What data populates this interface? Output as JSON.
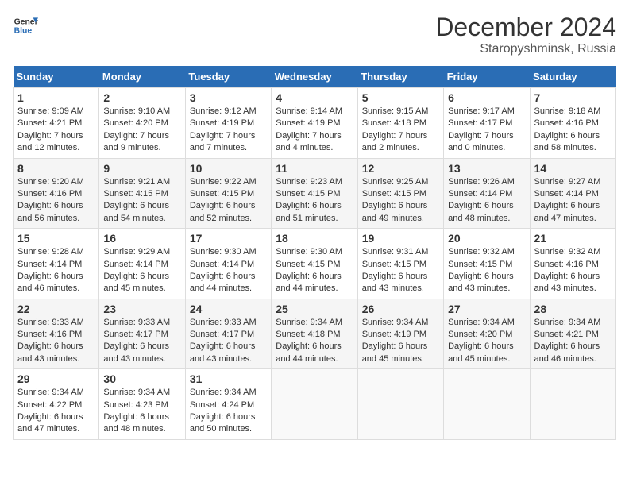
{
  "header": {
    "logo_line1": "General",
    "logo_line2": "Blue",
    "month": "December 2024",
    "location": "Staropyshminsk, Russia"
  },
  "days_of_week": [
    "Sunday",
    "Monday",
    "Tuesday",
    "Wednesday",
    "Thursday",
    "Friday",
    "Saturday"
  ],
  "weeks": [
    [
      {
        "day": "1",
        "sunrise": "9:09 AM",
        "sunset": "4:21 PM",
        "daylight": "7 hours and 12 minutes."
      },
      {
        "day": "2",
        "sunrise": "9:10 AM",
        "sunset": "4:20 PM",
        "daylight": "7 hours and 9 minutes."
      },
      {
        "day": "3",
        "sunrise": "9:12 AM",
        "sunset": "4:19 PM",
        "daylight": "7 hours and 7 minutes."
      },
      {
        "day": "4",
        "sunrise": "9:14 AM",
        "sunset": "4:19 PM",
        "daylight": "7 hours and 4 minutes."
      },
      {
        "day": "5",
        "sunrise": "9:15 AM",
        "sunset": "4:18 PM",
        "daylight": "7 hours and 2 minutes."
      },
      {
        "day": "6",
        "sunrise": "9:17 AM",
        "sunset": "4:17 PM",
        "daylight": "7 hours and 0 minutes."
      },
      {
        "day": "7",
        "sunrise": "9:18 AM",
        "sunset": "4:16 PM",
        "daylight": "6 hours and 58 minutes."
      }
    ],
    [
      {
        "day": "8",
        "sunrise": "9:20 AM",
        "sunset": "4:16 PM",
        "daylight": "6 hours and 56 minutes."
      },
      {
        "day": "9",
        "sunrise": "9:21 AM",
        "sunset": "4:15 PM",
        "daylight": "6 hours and 54 minutes."
      },
      {
        "day": "10",
        "sunrise": "9:22 AM",
        "sunset": "4:15 PM",
        "daylight": "6 hours and 52 minutes."
      },
      {
        "day": "11",
        "sunrise": "9:23 AM",
        "sunset": "4:15 PM",
        "daylight": "6 hours and 51 minutes."
      },
      {
        "day": "12",
        "sunrise": "9:25 AM",
        "sunset": "4:15 PM",
        "daylight": "6 hours and 49 minutes."
      },
      {
        "day": "13",
        "sunrise": "9:26 AM",
        "sunset": "4:14 PM",
        "daylight": "6 hours and 48 minutes."
      },
      {
        "day": "14",
        "sunrise": "9:27 AM",
        "sunset": "4:14 PM",
        "daylight": "6 hours and 47 minutes."
      }
    ],
    [
      {
        "day": "15",
        "sunrise": "9:28 AM",
        "sunset": "4:14 PM",
        "daylight": "6 hours and 46 minutes."
      },
      {
        "day": "16",
        "sunrise": "9:29 AM",
        "sunset": "4:14 PM",
        "daylight": "6 hours and 45 minutes."
      },
      {
        "day": "17",
        "sunrise": "9:30 AM",
        "sunset": "4:14 PM",
        "daylight": "6 hours and 44 minutes."
      },
      {
        "day": "18",
        "sunrise": "9:30 AM",
        "sunset": "4:15 PM",
        "daylight": "6 hours and 44 minutes."
      },
      {
        "day": "19",
        "sunrise": "9:31 AM",
        "sunset": "4:15 PM",
        "daylight": "6 hours and 43 minutes."
      },
      {
        "day": "20",
        "sunrise": "9:32 AM",
        "sunset": "4:15 PM",
        "daylight": "6 hours and 43 minutes."
      },
      {
        "day": "21",
        "sunrise": "9:32 AM",
        "sunset": "4:16 PM",
        "daylight": "6 hours and 43 minutes."
      }
    ],
    [
      {
        "day": "22",
        "sunrise": "9:33 AM",
        "sunset": "4:16 PM",
        "daylight": "6 hours and 43 minutes."
      },
      {
        "day": "23",
        "sunrise": "9:33 AM",
        "sunset": "4:17 PM",
        "daylight": "6 hours and 43 minutes."
      },
      {
        "day": "24",
        "sunrise": "9:33 AM",
        "sunset": "4:17 PM",
        "daylight": "6 hours and 43 minutes."
      },
      {
        "day": "25",
        "sunrise": "9:34 AM",
        "sunset": "4:18 PM",
        "daylight": "6 hours and 44 minutes."
      },
      {
        "day": "26",
        "sunrise": "9:34 AM",
        "sunset": "4:19 PM",
        "daylight": "6 hours and 45 minutes."
      },
      {
        "day": "27",
        "sunrise": "9:34 AM",
        "sunset": "4:20 PM",
        "daylight": "6 hours and 45 minutes."
      },
      {
        "day": "28",
        "sunrise": "9:34 AM",
        "sunset": "4:21 PM",
        "daylight": "6 hours and 46 minutes."
      }
    ],
    [
      {
        "day": "29",
        "sunrise": "9:34 AM",
        "sunset": "4:22 PM",
        "daylight": "6 hours and 47 minutes."
      },
      {
        "day": "30",
        "sunrise": "9:34 AM",
        "sunset": "4:23 PM",
        "daylight": "6 hours and 48 minutes."
      },
      {
        "day": "31",
        "sunrise": "9:34 AM",
        "sunset": "4:24 PM",
        "daylight": "6 hours and 50 minutes."
      },
      null,
      null,
      null,
      null
    ]
  ]
}
